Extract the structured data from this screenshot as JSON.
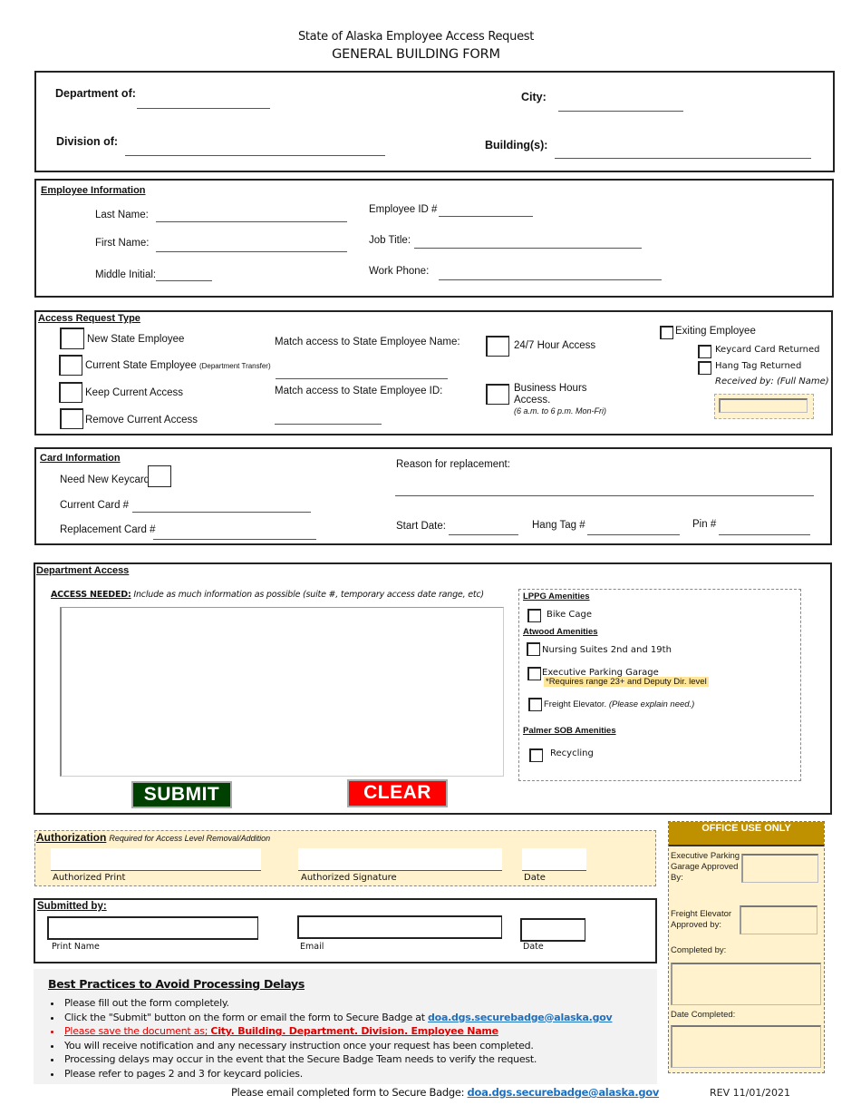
{
  "header": {
    "subtitle": "State of Alaska Employee Access Request",
    "title": "GENERAL BUILDING FORM"
  },
  "location": {
    "department_label": "Department of:",
    "division_label": "Division of:",
    "city_label": "City:",
    "buildings_label": "Building(s):",
    "department_value": "",
    "division_value": "",
    "city_value": "",
    "buildings_value": ""
  },
  "employee": {
    "section_title": "Employee Information",
    "last_name_label": "Last Name:",
    "first_name_label": "First Name:",
    "middle_initial_label": "Middle Initial:",
    "employee_id_label": "Employee ID #",
    "job_title_label": "Job Title:",
    "work_phone_label": "Work Phone:",
    "last_name": "",
    "first_name": "",
    "middle_initial": "",
    "employee_id": "",
    "job_title": "",
    "work_phone": ""
  },
  "access_request": {
    "section_title": "Access Request Type",
    "options": [
      {
        "label": "New State Employee",
        "note": "",
        "checked": false
      },
      {
        "label": "Current State Employee",
        "note": "(Department Transfer)",
        "checked": false
      },
      {
        "label": "Keep Current Access",
        "note": "",
        "checked": false
      },
      {
        "label": "Remove Current Access",
        "note": "",
        "checked": false
      }
    ],
    "match_name_label": "Match access to State Employee Name:",
    "match_id_label": "Match access to State Employee ID:",
    "match_name": "",
    "match_id": "",
    "hour_access_label": "24/7 Hour Access",
    "business_hours_label": "Business Hours Access.",
    "business_hours_note": "(6 a.m. to 6 p.m. Mon-Fri)",
    "exiting_label": "Exiting Employee",
    "keycard_returned_label": "Keycard Card Returned",
    "hang_tag_returned_label": "Hang Tag Returned",
    "received_by_label": "Received by: (Full Name)",
    "received_by": ""
  },
  "card": {
    "section_title": "Card Information",
    "need_new_label": "Need New Keycard",
    "current_card_label": "Current Card #",
    "replacement_card_label": "Replacement Card #",
    "reason_label": "Reason for replacement:",
    "start_date_label": "Start Date:",
    "hang_tag_label": "Hang Tag #",
    "pin_label": "Pin #",
    "current_card": "",
    "replacement_card": "",
    "reason": "",
    "start_date": "",
    "hang_tag": "",
    "pin": ""
  },
  "department_access": {
    "section_title": "Department Access",
    "access_needed_label": "ACCESS NEEDED:",
    "access_needed_hint": "Include as much information as possible (suite #, temporary access date range, etc)",
    "access_needed_value": "",
    "submit_label": "SUBMIT",
    "clear_label": "CLEAR",
    "amenities": {
      "lppg_title": "LPPG Amenities",
      "bike_cage": "Bike Cage",
      "atwood_title": "Atwood Amenities",
      "nursing_suites": "Nursing Suites 2nd and 19th",
      "exec_parking": "Executive Parking Garage",
      "exec_parking_note": "*Requires range 23+ and Deputy Dir. level",
      "freight_elevator": "Freight Elevator.",
      "freight_elevator_note": "(Please explain need.)",
      "palmer_title": "Palmer SOB Amenities",
      "recycling": "Recycling"
    }
  },
  "authorization": {
    "title": "Authorization",
    "subtitle": "Required for Access Level Removal/Addition",
    "print_label": "Authorized Print",
    "signature_label": "Authorized Signature",
    "date_label": "Date"
  },
  "submitted_by": {
    "title": "Submitted by:",
    "print_name_label": "Print Name",
    "email_label": "Email",
    "date_label": "Date"
  },
  "office_use": {
    "title": "OFFICE USE ONLY",
    "exec_parking_label": "Executive Parking Garage Approved By:",
    "freight_label": "Freight Elevator Approved by:",
    "completed_by_label": "Completed by:",
    "date_completed_label": "Date Completed:"
  },
  "best_practices": {
    "title": "Best Practices to Avoid Processing Delays",
    "items": [
      "Please fill out the form completely.",
      "Click the \"Submit\" button on the form or email the form to Secure Badge at ",
      "Please save the document as; ",
      "You will receive notification and any necessary instruction once your request has been completed.",
      "Processing delays may occur in the event that the Secure Badge Team needs to verify the request.",
      "Please refer to pages 2 and 3 for keycard policies."
    ],
    "save_as_format": "City. Building. Department. Division. Employee Name",
    "email": "doa.dgs.securebadge@alaska.gov"
  },
  "footer": {
    "email_prompt": "Please email completed form to Secure Badge: ",
    "email": "doa.dgs.securebadge@alaska.gov",
    "revision": "REV 11/01/2021"
  },
  "colors": {
    "submit": "#004000",
    "clear": "#ff0000",
    "office_header": "#bf9000",
    "tan_bg": "#fff2cc",
    "link": "#1f6fbf"
  }
}
